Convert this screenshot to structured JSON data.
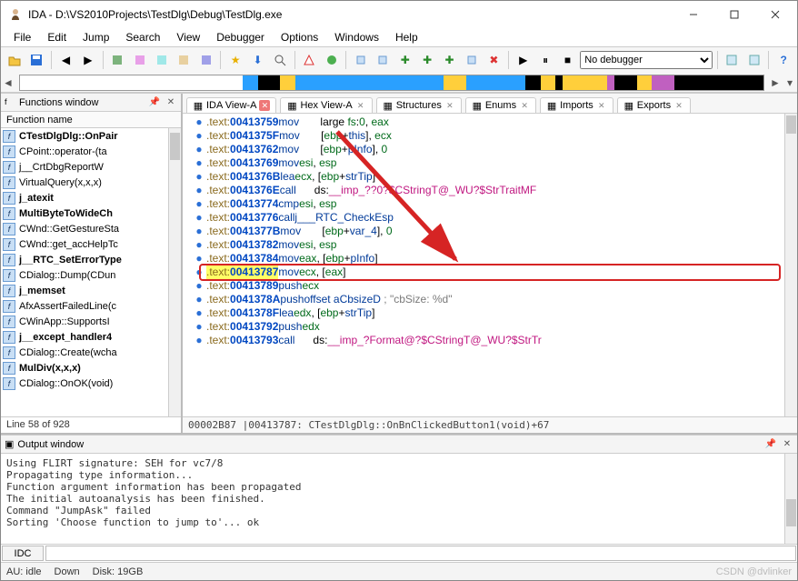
{
  "title": "IDA - D:\\VS2010Projects\\TestDlg\\Debug\\TestDlg.exe",
  "menu": [
    "File",
    "Edit",
    "Jump",
    "Search",
    "View",
    "Debugger",
    "Options",
    "Windows",
    "Help"
  ],
  "debugger_select": "No debugger",
  "left_panel": {
    "title": "Functions window",
    "col": "Function name",
    "status": "Line 58 of 928",
    "items": [
      "CTestDlgDlg::OnPair",
      "CPoint::operator-(ta",
      "j__CrtDbgReportW",
      "VirtualQuery(x,x,x)",
      "j_atexit",
      "MultiByteToWideCh",
      "CWnd::GetGestureSta",
      "CWnd::get_accHelpTc",
      "j__RTC_SetErrorType",
      "CDialog::Dump(CDun",
      "j_memset",
      "AfxAssertFailedLine(c",
      "CWinApp::SupportsI",
      "j__except_handler4",
      "CDialog::Create(wcha",
      "MulDiv(x,x,x)",
      "CDialog::OnOK(void)"
    ]
  },
  "tabs": [
    {
      "label": "IDA View-A",
      "active": true,
      "icon": "view"
    },
    {
      "label": "Hex View-A",
      "active": false,
      "icon": "hex"
    },
    {
      "label": "Structures",
      "active": false,
      "icon": "struct"
    },
    {
      "label": "Enums",
      "active": false,
      "icon": "enum"
    },
    {
      "label": "Imports",
      "active": false,
      "icon": "import"
    },
    {
      "label": "Exports",
      "active": false,
      "icon": "export"
    }
  ],
  "disasm": {
    "status": "00002B87 |00413787: CTestDlgDlg::OnBnClickedButton1(void)+67",
    "lines": [
      {
        "addr": "00413759",
        "mn": "mov",
        "ops": [
          {
            "t": "txt",
            "v": "large "
          },
          {
            "t": "reg",
            "v": "fs"
          },
          {
            "t": "txt",
            "v": ":"
          },
          {
            "t": "num",
            "v": "0"
          },
          {
            "t": "txt",
            "v": ", "
          },
          {
            "t": "reg",
            "v": "eax"
          }
        ]
      },
      {
        "addr": "0041375F",
        "mn": "mov",
        "ops": [
          {
            "t": "txt",
            "v": "["
          },
          {
            "t": "reg",
            "v": "ebp"
          },
          {
            "t": "txt",
            "v": "+"
          },
          {
            "t": "sym",
            "v": "this"
          },
          {
            "t": "txt",
            "v": "], "
          },
          {
            "t": "reg",
            "v": "ecx"
          }
        ]
      },
      {
        "addr": "00413762",
        "mn": "mov",
        "ops": [
          {
            "t": "txt",
            "v": "["
          },
          {
            "t": "reg",
            "v": "ebp"
          },
          {
            "t": "txt",
            "v": "+"
          },
          {
            "t": "sym",
            "v": "pInfo"
          },
          {
            "t": "txt",
            "v": "], "
          },
          {
            "t": "num",
            "v": "0"
          }
        ]
      },
      {
        "addr": "00413769",
        "mn": "mov",
        "ops": [
          {
            "t": "reg",
            "v": "esi"
          },
          {
            "t": "txt",
            "v": ", "
          },
          {
            "t": "reg",
            "v": "esp"
          }
        ]
      },
      {
        "addr": "0041376B",
        "mn": "lea",
        "ops": [
          {
            "t": "reg",
            "v": "ecx"
          },
          {
            "t": "txt",
            "v": ", ["
          },
          {
            "t": "reg",
            "v": "ebp"
          },
          {
            "t": "txt",
            "v": "+"
          },
          {
            "t": "sym",
            "v": "strTip"
          },
          {
            "t": "txt",
            "v": "]"
          }
        ]
      },
      {
        "addr": "0041376E",
        "mn": "call",
        "ops": [
          {
            "t": "txt",
            "v": "ds:"
          },
          {
            "t": "imp",
            "v": "__imp_??0?$CStringT@_WU?$StrTraitMF"
          }
        ]
      },
      {
        "addr": "00413774",
        "mn": "cmp",
        "ops": [
          {
            "t": "reg",
            "v": "esi"
          },
          {
            "t": "txt",
            "v": ", "
          },
          {
            "t": "reg",
            "v": "esp"
          }
        ]
      },
      {
        "addr": "00413776",
        "mn": "call",
        "ops": [
          {
            "t": "sym",
            "v": "j___RTC_CheckEsp"
          }
        ]
      },
      {
        "addr": "0041377B",
        "mn": "mov",
        "ops": [
          {
            "t": "txt",
            "v": "["
          },
          {
            "t": "reg",
            "v": "ebp"
          },
          {
            "t": "txt",
            "v": "+"
          },
          {
            "t": "sym",
            "v": "var_4"
          },
          {
            "t": "txt",
            "v": "], "
          },
          {
            "t": "num",
            "v": "0"
          }
        ]
      },
      {
        "addr": "00413782",
        "mn": "mov",
        "ops": [
          {
            "t": "reg",
            "v": "esi"
          },
          {
            "t": "txt",
            "v": ", "
          },
          {
            "t": "reg",
            "v": "esp"
          }
        ]
      },
      {
        "addr": "00413784",
        "mn": "mov",
        "ops": [
          {
            "t": "reg",
            "v": "eax"
          },
          {
            "t": "txt",
            "v": ", ["
          },
          {
            "t": "reg",
            "v": "ebp"
          },
          {
            "t": "txt",
            "v": "+"
          },
          {
            "t": "sym",
            "v": "pInfo"
          },
          {
            "t": "txt",
            "v": "]"
          }
        ]
      },
      {
        "addr": "00413787",
        "mn": "mov",
        "hl": true,
        "ops": [
          {
            "t": "reg",
            "v": "ecx"
          },
          {
            "t": "txt",
            "v": ", ["
          },
          {
            "t": "reg",
            "v": "eax"
          },
          {
            "t": "txt",
            "v": "]"
          }
        ]
      },
      {
        "addr": "00413789",
        "mn": "push",
        "ops": [
          {
            "t": "reg",
            "v": "ecx"
          }
        ]
      },
      {
        "addr": "0041378A",
        "mn": "push",
        "ops": [
          {
            "t": "sym",
            "v": "offset aCbsizeD"
          },
          {
            "t": "cmt",
            "v": " ; \"cbSize: %d\""
          }
        ]
      },
      {
        "addr": "0041378F",
        "mn": "lea",
        "ops": [
          {
            "t": "reg",
            "v": "edx"
          },
          {
            "t": "txt",
            "v": ", ["
          },
          {
            "t": "reg",
            "v": "ebp"
          },
          {
            "t": "txt",
            "v": "+"
          },
          {
            "t": "sym",
            "v": "strTip"
          },
          {
            "t": "txt",
            "v": "]"
          }
        ]
      },
      {
        "addr": "00413792",
        "mn": "push",
        "ops": [
          {
            "t": "reg",
            "v": "edx"
          }
        ]
      },
      {
        "addr": "00413793",
        "mn": "call",
        "ops": [
          {
            "t": "txt",
            "v": "ds:"
          },
          {
            "t": "imp",
            "v": "__imp_?Format@?$CStringT@_WU?$StrTr"
          }
        ]
      }
    ]
  },
  "output": {
    "title": "Output window",
    "lines": [
      "Using FLIRT signature: SEH for vc7/8",
      "Propagating type information...",
      "Function argument information has been propagated",
      "The initial autoanalysis has been finished.",
      "Command \"JumpAsk\" failed",
      "Sorting 'Choose function to jump to'... ok"
    ],
    "cmd_label": "IDC"
  },
  "status": {
    "au": "AU:  idle",
    "down": "Down",
    "disk": "Disk: 19GB"
  },
  "watermark": "CSDN @dvlinker",
  "overview_segments": [
    {
      "l": 0,
      "w": 30,
      "c": "#ffffff"
    },
    {
      "l": 30,
      "w": 2,
      "c": "#2aa0ff"
    },
    {
      "l": 32,
      "w": 3,
      "c": "#000"
    },
    {
      "l": 35,
      "w": 2,
      "c": "#ffcf3b"
    },
    {
      "l": 37,
      "w": 20,
      "c": "#2aa0ff"
    },
    {
      "l": 57,
      "w": 3,
      "c": "#ffcf3b"
    },
    {
      "l": 60,
      "w": 8,
      "c": "#2aa0ff"
    },
    {
      "l": 68,
      "w": 2,
      "c": "#000"
    },
    {
      "l": 70,
      "w": 2,
      "c": "#ffcf3b"
    },
    {
      "l": 72,
      "w": 1,
      "c": "#000"
    },
    {
      "l": 73,
      "w": 6,
      "c": "#ffcf3b"
    },
    {
      "l": 79,
      "w": 1,
      "c": "#c060c0"
    },
    {
      "l": 80,
      "w": 3,
      "c": "#000"
    },
    {
      "l": 83,
      "w": 2,
      "c": "#ffcf3b"
    },
    {
      "l": 85,
      "w": 3,
      "c": "#c060c0"
    },
    {
      "l": 88,
      "w": 12,
      "c": "#000"
    }
  ]
}
